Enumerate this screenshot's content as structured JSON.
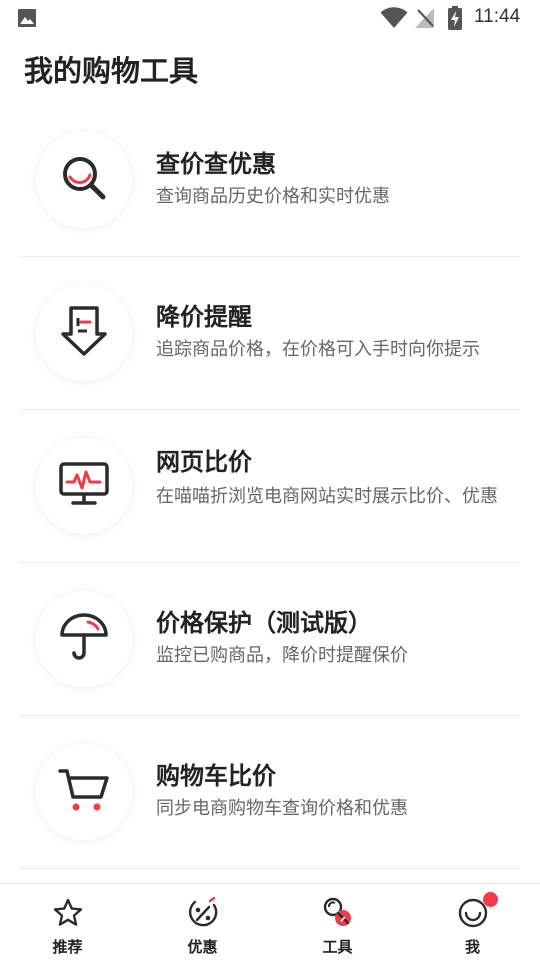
{
  "status_bar": {
    "time": "11:44",
    "icons": [
      "image-icon",
      "wifi-icon",
      "no-signal-icon",
      "battery-charging-icon"
    ]
  },
  "page": {
    "title": "我的购物工具"
  },
  "colors": {
    "accent": "#f23b47",
    "icon_dark": "#2b2b2b",
    "desc_text": "#666666"
  },
  "tools": [
    {
      "title": "查价查优惠",
      "desc": "查询商品历史价格和实时优惠",
      "icon": "magnifier-icon"
    },
    {
      "title": "降价提醒",
      "desc": "追踪商品价格，在价格可入手时向你提示",
      "icon": "price-drop-icon"
    },
    {
      "title": "网页比价",
      "desc": "在喵喵折浏览电商网站实时展示比价、优惠",
      "icon": "monitor-icon"
    },
    {
      "title": "价格保护（测试版）",
      "desc": "监控已购商品，降价时提醒保价",
      "icon": "umbrella-icon"
    },
    {
      "title": "购物车比价",
      "desc": "同步电商购物车查询价格和优惠",
      "icon": "cart-icon"
    }
  ],
  "bottom_nav": [
    {
      "label": "推荐",
      "icon": "star-icon"
    },
    {
      "label": "优惠",
      "icon": "discount-icon"
    },
    {
      "label": "工具",
      "icon": "tools-icon"
    },
    {
      "label": "我",
      "icon": "smile-icon",
      "has_notification": true
    }
  ]
}
